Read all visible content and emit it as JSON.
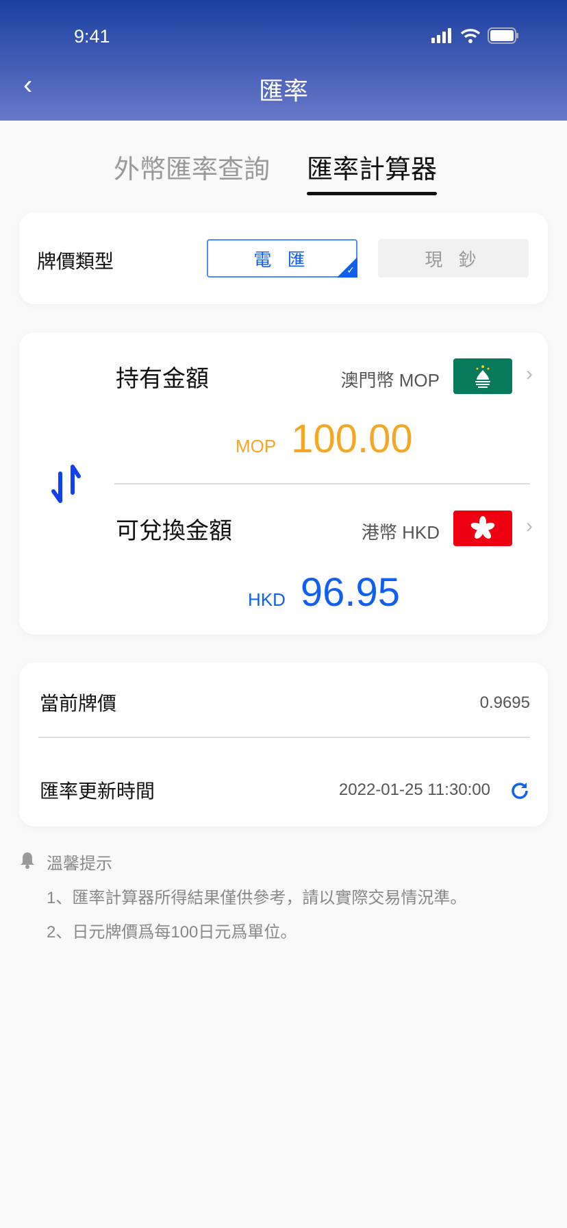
{
  "status_bar": {
    "time": "9:41"
  },
  "header": {
    "title": "匯率"
  },
  "tabs": [
    {
      "label": "外幣匯率查詢",
      "active": false
    },
    {
      "label": "匯率計算器",
      "active": true
    }
  ],
  "rate_type": {
    "label": "牌價類型",
    "options": [
      {
        "label": "電 匯",
        "selected": true
      },
      {
        "label": "現 鈔",
        "selected": false
      }
    ]
  },
  "converter": {
    "from": {
      "label": "持有金額",
      "currency_name": "澳門幣 MOP",
      "code": "MOP",
      "amount": "100.00",
      "flag": "macau-flag"
    },
    "to": {
      "label": "可兌換金額",
      "currency_name": "港幣 HKD",
      "code": "HKD",
      "amount": "96.95",
      "flag": "hong-kong-flag"
    }
  },
  "info": {
    "rate_label": "當前牌價",
    "rate_value": "0.9695",
    "update_label": "匯率更新時間",
    "update_value": "2022-01-25  11:30:00"
  },
  "tips": {
    "title": "溫馨提示",
    "items": [
      "1、匯率計算器所得結果僅供參考，請以實際交易情況準。",
      "2、日元牌價爲每100日元爲單位。"
    ]
  },
  "colors": {
    "accent": "#1060f0",
    "from_amount": "#f5a623",
    "macau_green": "#067a5b",
    "hk_red": "#ee0010"
  }
}
